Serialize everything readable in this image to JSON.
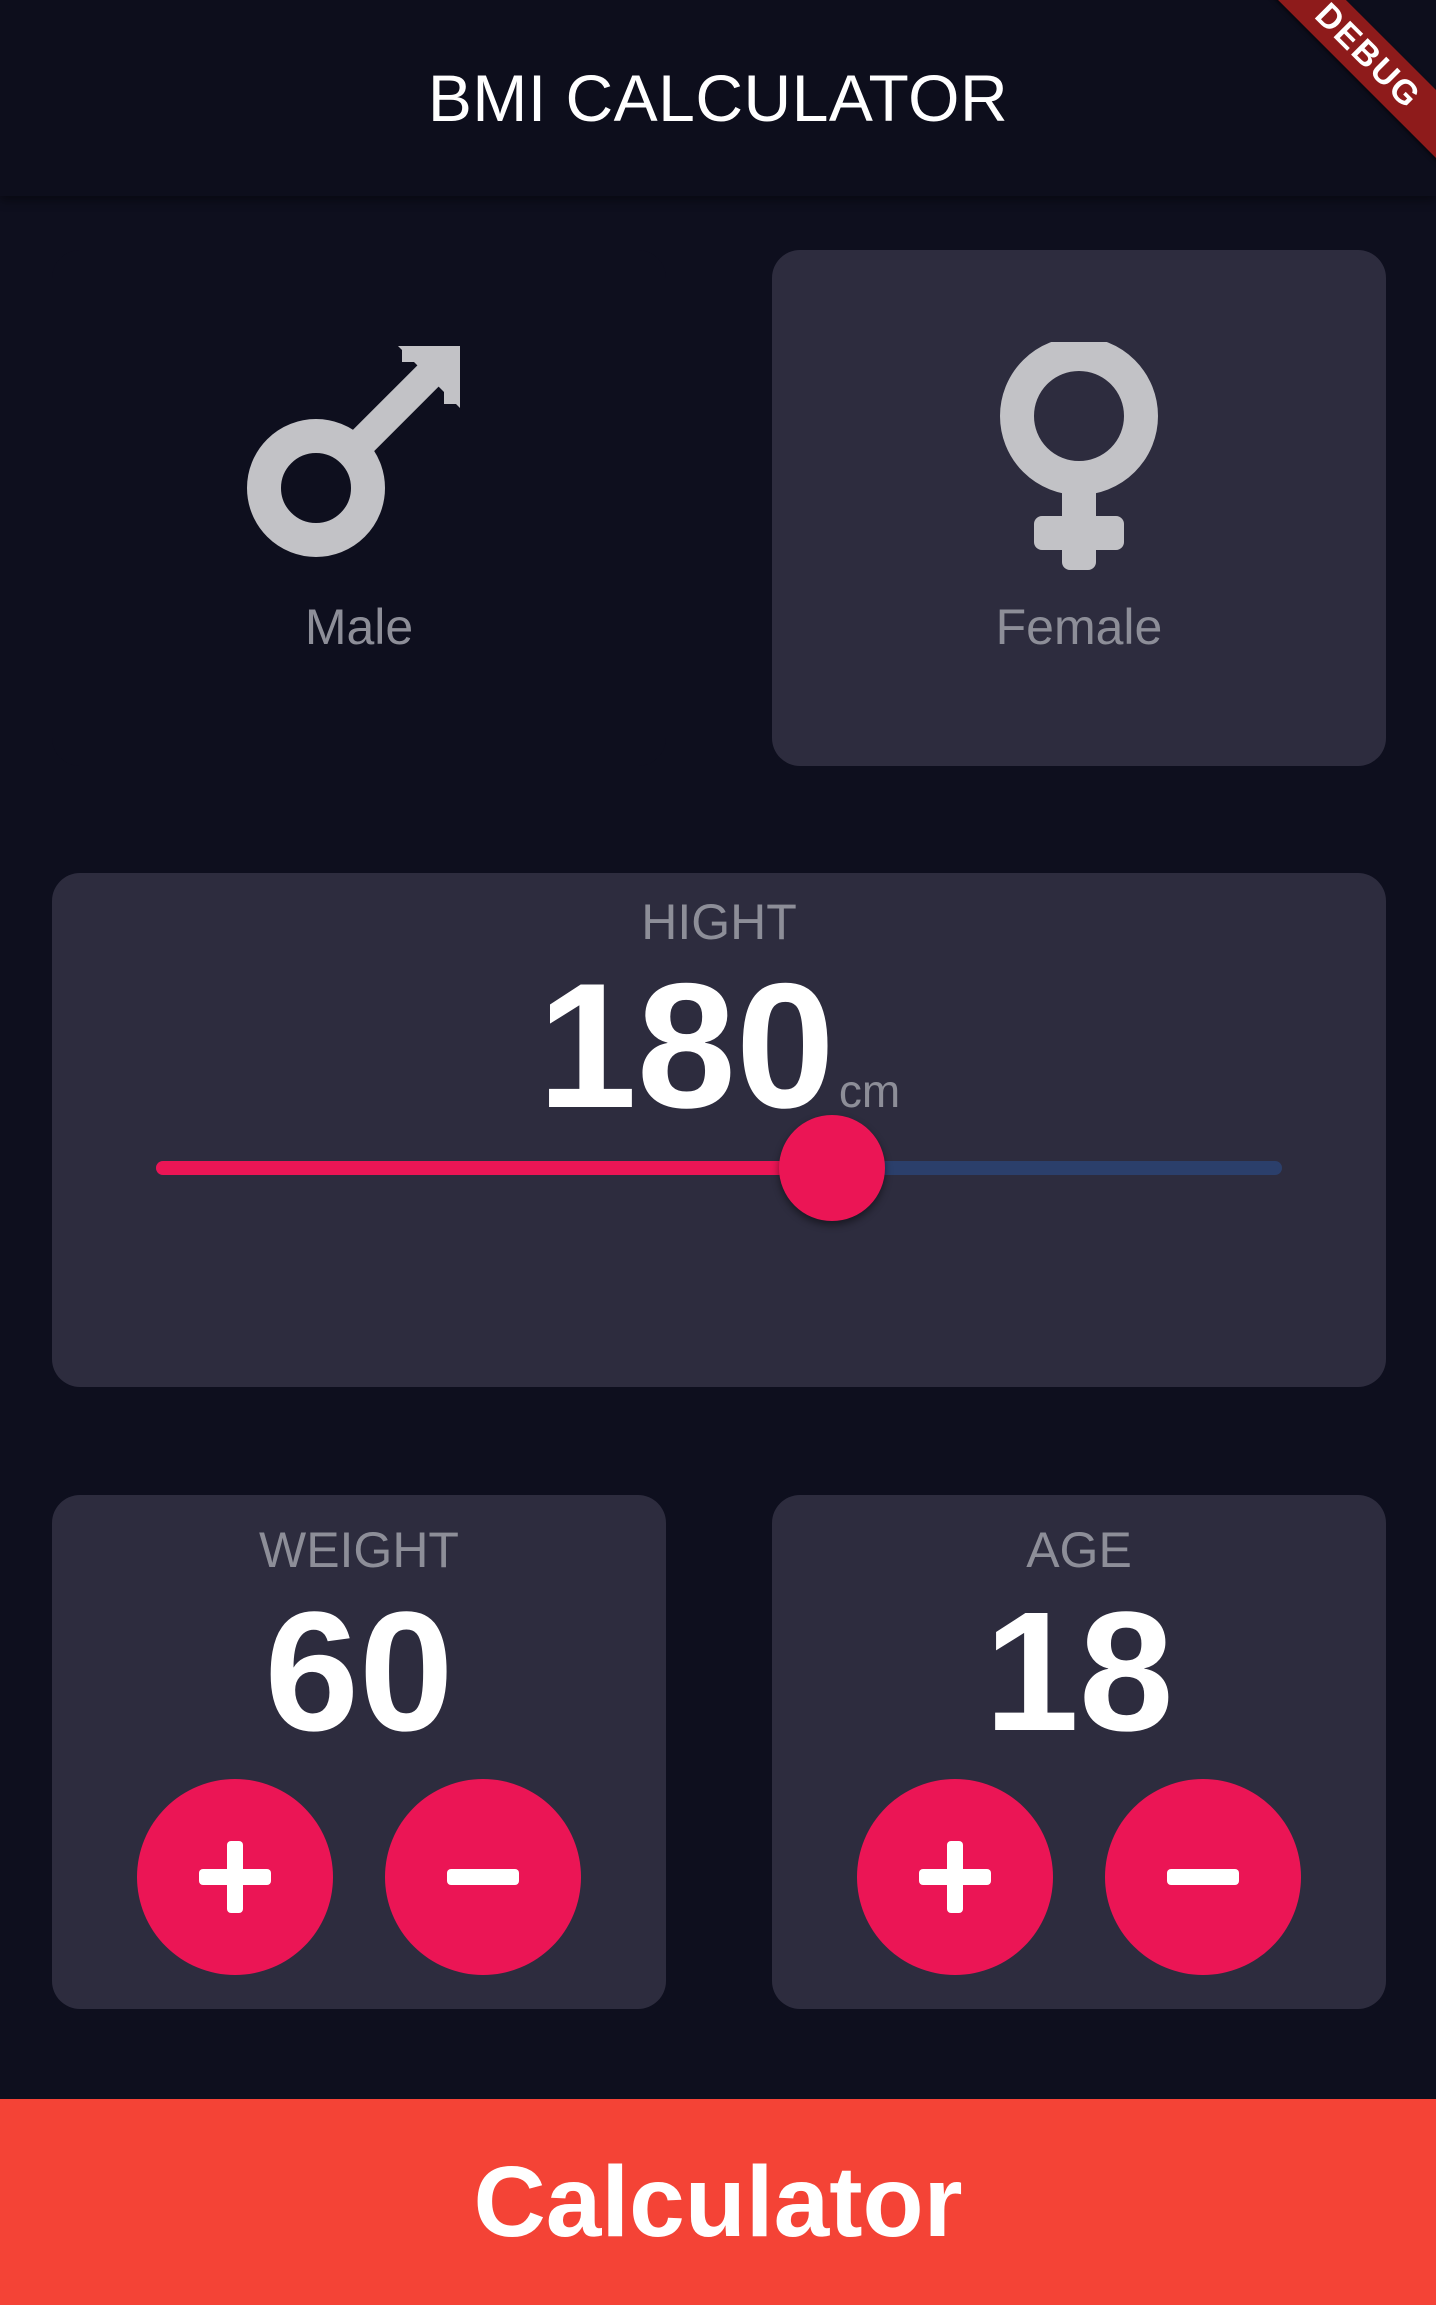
{
  "appbar": {
    "title": "BMI CALCULATOR"
  },
  "debug_banner": "DEBUG",
  "gender": {
    "male": {
      "label": "Male",
      "icon": "male-symbol-icon",
      "selected": false
    },
    "female": {
      "label": "Female",
      "icon": "female-symbol-icon",
      "selected": true
    }
  },
  "height": {
    "label": "HIGHT",
    "value": "180",
    "unit": "cm",
    "slider_fraction": 0.6
  },
  "weight": {
    "label": "WEIGHT",
    "value": "60",
    "plus_icon": "plus-icon",
    "minus_icon": "minus-icon"
  },
  "age": {
    "label": "AGE",
    "value": "18",
    "plus_icon": "plus-icon",
    "minus_icon": "minus-icon"
  },
  "bottom_button": {
    "label": "Calculator"
  },
  "colors": {
    "background": "#0e0f1e",
    "card": "#2d2c3e",
    "accent": "#eb1555",
    "bottom_button": "#f44336",
    "label": "#8d8e98",
    "icon": "#c2c2c6",
    "slider_inactive": "#2b3f6b"
  }
}
